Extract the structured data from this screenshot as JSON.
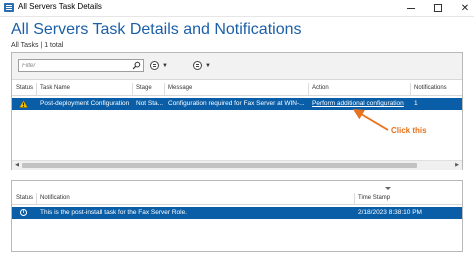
{
  "window": {
    "title": "All Servers Task Details",
    "icon": "task-details-icon",
    "controls": {
      "minimize": "",
      "maximize": "",
      "close": "✕"
    }
  },
  "page": {
    "heading": "All Servers Task Details and Notifications",
    "count_label": "All Tasks | 1 total"
  },
  "toolbar": {
    "filter_placeholder": "Filter",
    "view_caret": "▼",
    "options_caret": "▼"
  },
  "tasks": {
    "columns": [
      "Status",
      "Task Name",
      "Stage",
      "Message",
      "Action",
      "Notifications"
    ],
    "row": {
      "status_icon": "warning-icon",
      "task_name": "Post-deployment Configuration",
      "stage": "Not Sta...",
      "message": "Configuration required for Fax Server at WIN-...",
      "action": "Perform additional configuration",
      "notifications": "1"
    }
  },
  "annotation": {
    "callout_text": "Click this",
    "color": "#e8731e"
  },
  "notifications_panel": {
    "columns": [
      "Status",
      "Notification",
      "Time Stamp"
    ],
    "row": {
      "status_icon": "info-icon",
      "notification": "This is the post-install task for the Fax Server Role.",
      "timestamp": "2/18/2023 8:38:10 PM"
    }
  },
  "colors": {
    "accent": "#1b5fa8",
    "selection": "#0a5ea8",
    "callout": "#e8731e"
  }
}
